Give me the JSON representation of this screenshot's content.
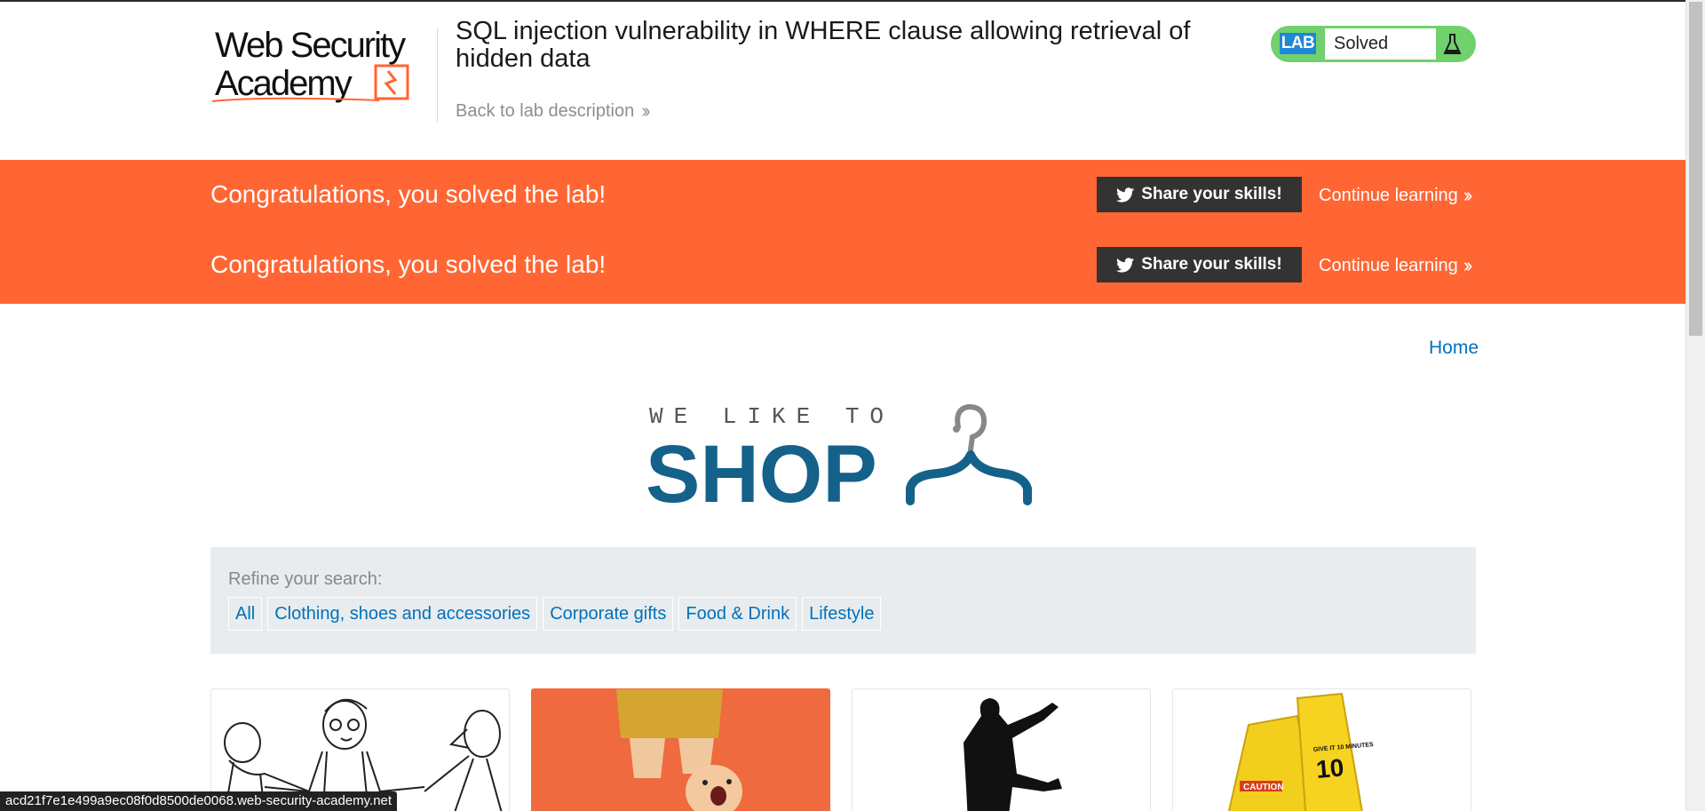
{
  "header": {
    "logo_text_line1": "Web Security",
    "logo_text_line2": "Academy",
    "lab_title": "SQL injection vulnerability in WHERE clause allowing retrieval of hidden data",
    "back_link": "Back to lab description",
    "lab_badge": {
      "tag": "LAB",
      "status": "Solved",
      "color": "#70d16d"
    }
  },
  "banner": {
    "color": "#ff6633",
    "rows": [
      {
        "message": "Congratulations, you solved the lab!",
        "share": "Share your skills!",
        "continue": "Continue learning"
      },
      {
        "message": "Congratulations, you solved the lab!",
        "share": "Share your skills!",
        "continue": "Continue learning"
      }
    ]
  },
  "nav": {
    "home": "Home"
  },
  "shop_logo": {
    "tagline": "WE LIKE TO",
    "word": "SHOP"
  },
  "filter": {
    "label": "Refine your search:",
    "categories": [
      "All",
      "Clothing, shoes and accessories",
      "Corporate gifts",
      "Food & Drink",
      "Lifestyle"
    ]
  },
  "products": [
    {
      "image": "cartoon-people-image"
    },
    {
      "image": "toy-figure-image"
    },
    {
      "image": "silhouette-image"
    },
    {
      "image": "caution-signs-image",
      "sign_text": "CAUTION",
      "sign_text_2": "GIVE IT 10 MINUTES"
    }
  ],
  "status_bar": {
    "url": "acd21f7e1e499a9ec08f0d8500de0068.web-security-academy.net"
  }
}
